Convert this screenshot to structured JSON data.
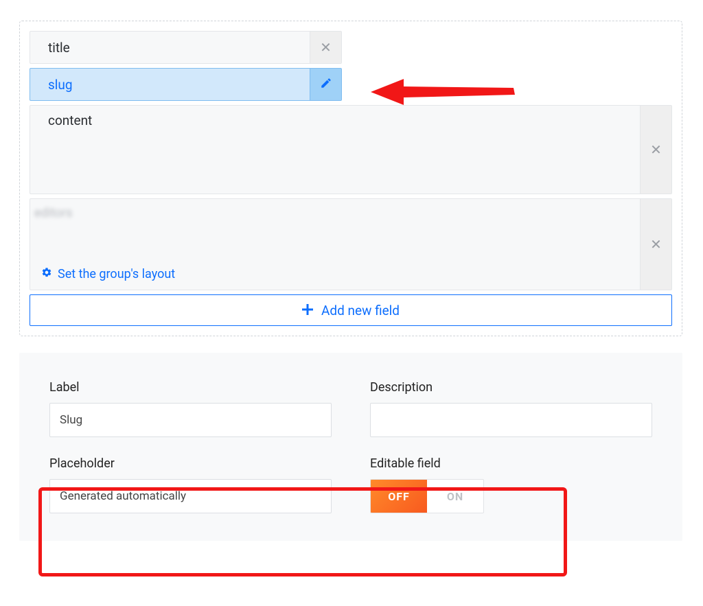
{
  "fields": {
    "title": {
      "label": "title"
    },
    "slug": {
      "label": "slug"
    },
    "content": {
      "label": "content"
    },
    "group_blurred": {
      "label": "editors"
    },
    "layout_link": "Set the group's layout",
    "add_button": "Add new field"
  },
  "settings": {
    "label_title": "Label",
    "label_value": "Slug",
    "description_title": "Description",
    "description_value": "",
    "placeholder_title": "Placeholder",
    "placeholder_value": "Generated automatically",
    "editable_title": "Editable field",
    "toggle_off": "OFF",
    "toggle_on": "ON",
    "toggle_state": "off"
  }
}
